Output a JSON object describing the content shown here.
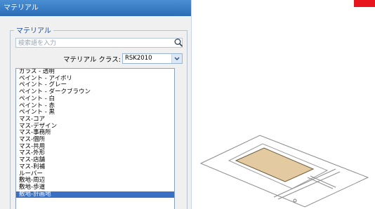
{
  "window": {
    "title": "マテリアル"
  },
  "group": {
    "label": "マテリアル"
  },
  "search": {
    "placeholder": "検索語を入力",
    "icon": "search-icon"
  },
  "material_class": {
    "label": "マテリアル クラス:",
    "value": "RSK2010"
  },
  "materials": [
    "ガラス - 透明",
    "ペイント - アイボリ",
    "ペイント - グレー",
    "ペイント - ダークブラウン",
    "ペイント - 白",
    "ペイント - 赤",
    "ペイント - 黒",
    "マス-コア",
    "マス-デザイン",
    "マス-事務所",
    "マス-個所",
    "マス-共用",
    "マス-外形",
    "マス-店舗",
    "マス-利補",
    "ルーバー",
    "敷地-周辺",
    "敷地-歩道",
    "敷地-計画地"
  ],
  "selected_index": 18,
  "colors": {
    "accent": "#e8141e",
    "selection": "#3a6fc4",
    "site_fill": "#e3caa0"
  }
}
